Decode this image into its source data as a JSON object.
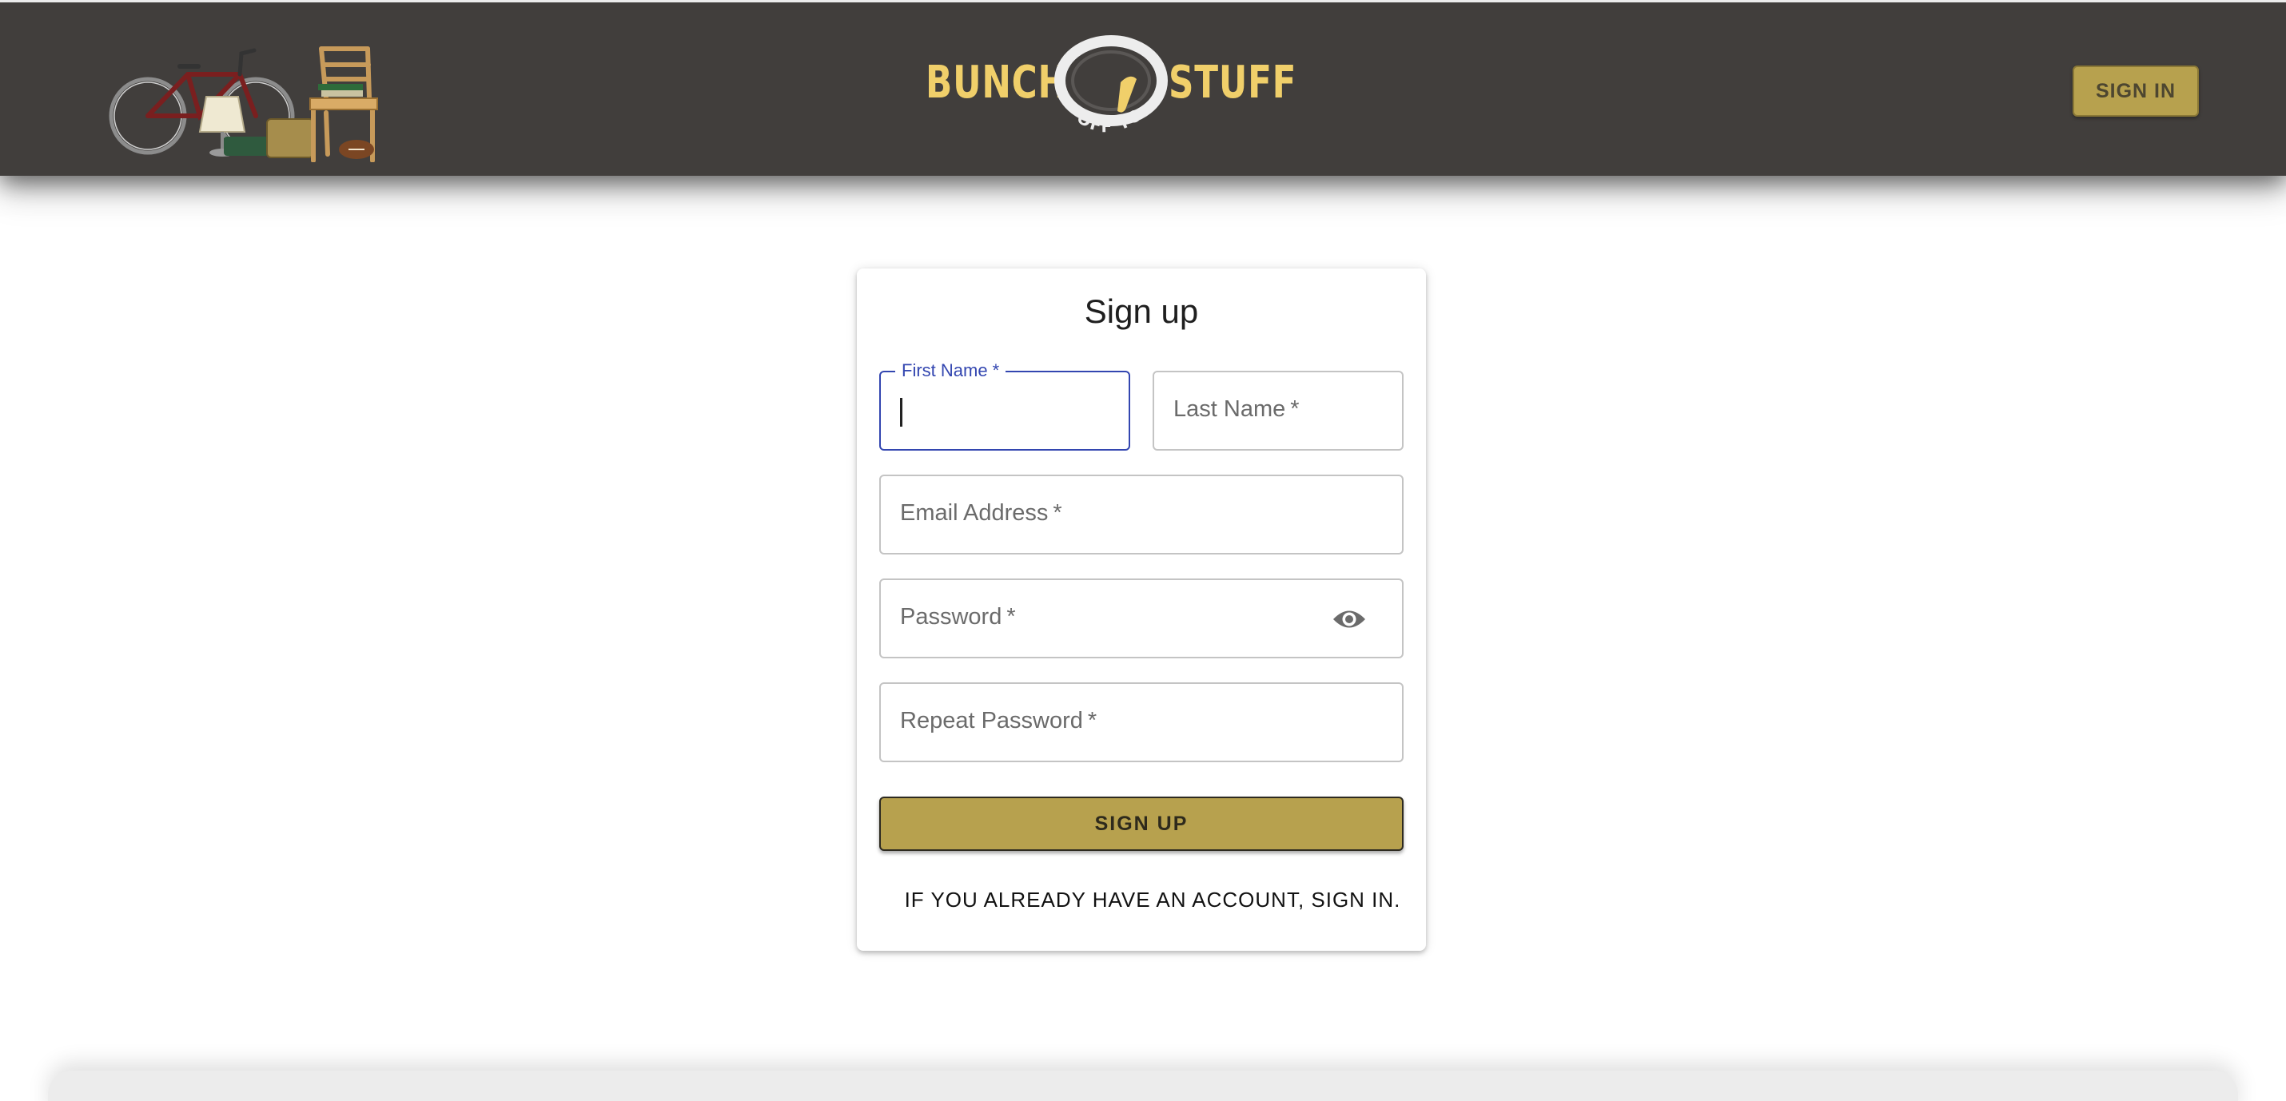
{
  "header": {
    "brand": {
      "left_word": "BUNCH",
      "right_word": "STUFF",
      "arc_text": "OFF YOUR"
    },
    "illustration_icon": "household-items-illustration",
    "signin_label": "SIGN IN"
  },
  "form": {
    "title": "Sign up",
    "fields": {
      "first_name": {
        "label": "First Name",
        "required_mark": "*",
        "value": "",
        "focused": true
      },
      "last_name": {
        "label": "Last Name",
        "required_mark": "*",
        "value": ""
      },
      "email": {
        "label": "Email Address",
        "required_mark": "*",
        "value": ""
      },
      "password": {
        "label": "Password",
        "required_mark": "*",
        "value": "",
        "toggle_icon": "eye-icon"
      },
      "repeat_password": {
        "label": "Repeat Password",
        "required_mark": "*",
        "value": ""
      }
    },
    "submit_label": "SIGN UP",
    "signin_prompt": "IF YOU ALREADY HAVE AN ACCOUNT, SIGN IN."
  },
  "colors": {
    "header_bg": "#413e3c",
    "brand_yellow": "#f0cf6a",
    "button_gold": "#b7a14e",
    "focus_blue": "#3346b0"
  }
}
